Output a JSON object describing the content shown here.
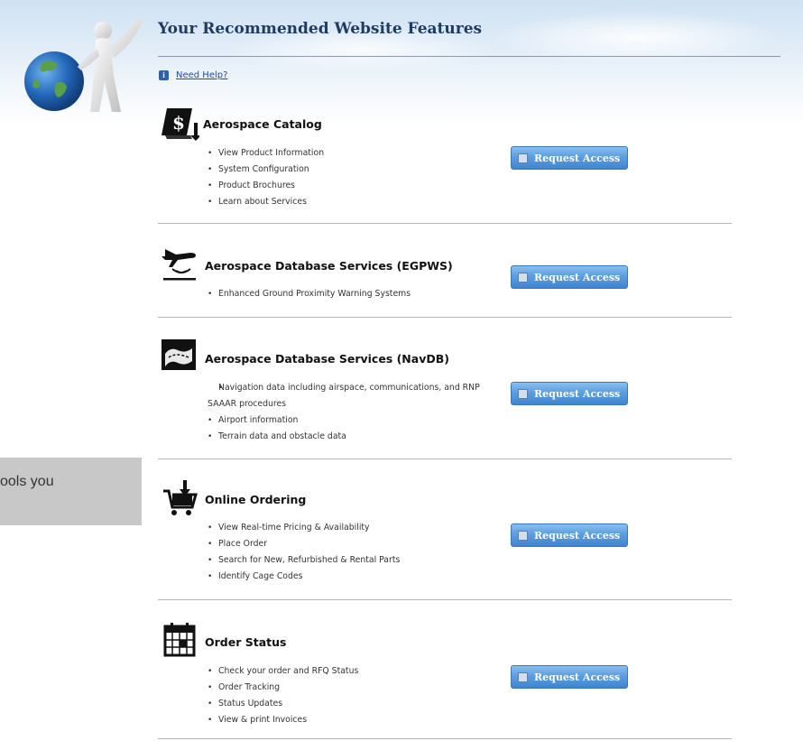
{
  "header": {
    "title": "Your Recommended Website Features",
    "help_label": "Need Help?"
  },
  "side_note": {
    "text": "ools you"
  },
  "features": [
    {
      "name": "Aerospace Catalog",
      "icon": "catalog-dollar-icon",
      "bullets": [
        "View Product Information",
        "System Configuration",
        "Product Brochures",
        "Learn about Services"
      ],
      "button": "Request Access"
    },
    {
      "name": "Aerospace Database Services (EGPWS)",
      "icon": "airplane-landing-icon",
      "bullets": [
        "Enhanced Ground Proximity Warning Systems"
      ],
      "button": "Request Access"
    },
    {
      "name": "Aerospace Database Services (NavDB)",
      "icon": "navigation-map-icon",
      "bullets": [
        "Navigation data including airspace, communications, and RNP SAAAR procedures",
        "Airport information",
        "Terrain data and obstacle data"
      ],
      "button": "Request Access"
    },
    {
      "name": "Online Ordering",
      "icon": "shopping-cart-icon",
      "bullets": [
        "View Real-time Pricing & Availability",
        "Place Order",
        "Search for New, Refurbished & Rental Parts",
        "Identify Cage Codes"
      ],
      "button": "Request Access"
    },
    {
      "name": "Order Status",
      "icon": "calendar-icon",
      "bullets": [
        "Check your order and RFQ Status",
        "Order Tracking",
        "Status Updates",
        "View & print Invoices"
      ],
      "button": "Request Access"
    }
  ]
}
